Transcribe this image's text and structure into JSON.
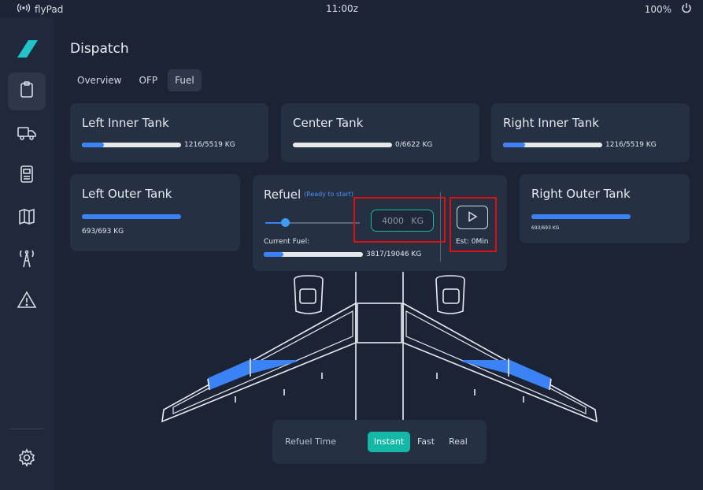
{
  "statusbar": {
    "app_name": "flyPad",
    "time": "11:00z",
    "battery": "100%"
  },
  "sidebar": {
    "items": [
      {
        "icon": "clipboard-icon",
        "active": true
      },
      {
        "icon": "truck-icon",
        "active": false
      },
      {
        "icon": "calculator-icon",
        "active": false
      },
      {
        "icon": "map-icon",
        "active": false
      },
      {
        "icon": "tower-icon",
        "active": false
      },
      {
        "icon": "warning-icon",
        "active": false
      }
    ],
    "settings_icon": "gear-icon"
  },
  "page": {
    "title": "Dispatch",
    "tabs": [
      {
        "label": "Overview",
        "active": false
      },
      {
        "label": "OFP",
        "active": false
      },
      {
        "label": "Fuel",
        "active": true
      }
    ]
  },
  "tanks": {
    "left_inner": {
      "title": "Left Inner Tank",
      "value": "1216/5519 KG",
      "fill": 0.22
    },
    "center": {
      "title": "Center Tank",
      "value": "0/6622 KG",
      "fill": 0.0
    },
    "right_inner": {
      "title": "Right Inner Tank",
      "value": "1216/5519 KG",
      "fill": 0.22
    },
    "left_outer": {
      "title": "Left Outer Tank",
      "value": "693/693 KG",
      "fill": 1.0
    },
    "right_outer": {
      "title": "Right Outer Tank",
      "value": "693/693 KG",
      "fill": 1.0
    }
  },
  "refuel": {
    "title": "Refuel",
    "status": "(Ready to start)",
    "slider_fraction": 0.21,
    "target_value": "4000",
    "target_unit": "KG",
    "current_fuel_label": "Current Fuel:",
    "current_fuel_value": "3817/19046 KG",
    "current_fuel_fill": 0.2,
    "estimate": "Est: 0Min"
  },
  "refuel_time": {
    "label": "Refuel Time",
    "options": [
      {
        "label": "Instant",
        "active": true
      },
      {
        "label": "Fast",
        "active": false
      },
      {
        "label": "Real",
        "active": false
      }
    ]
  },
  "colors": {
    "accent_teal": "#14b8a6",
    "fill_blue": "#3b82f6",
    "highlight_red": "#e01010"
  }
}
